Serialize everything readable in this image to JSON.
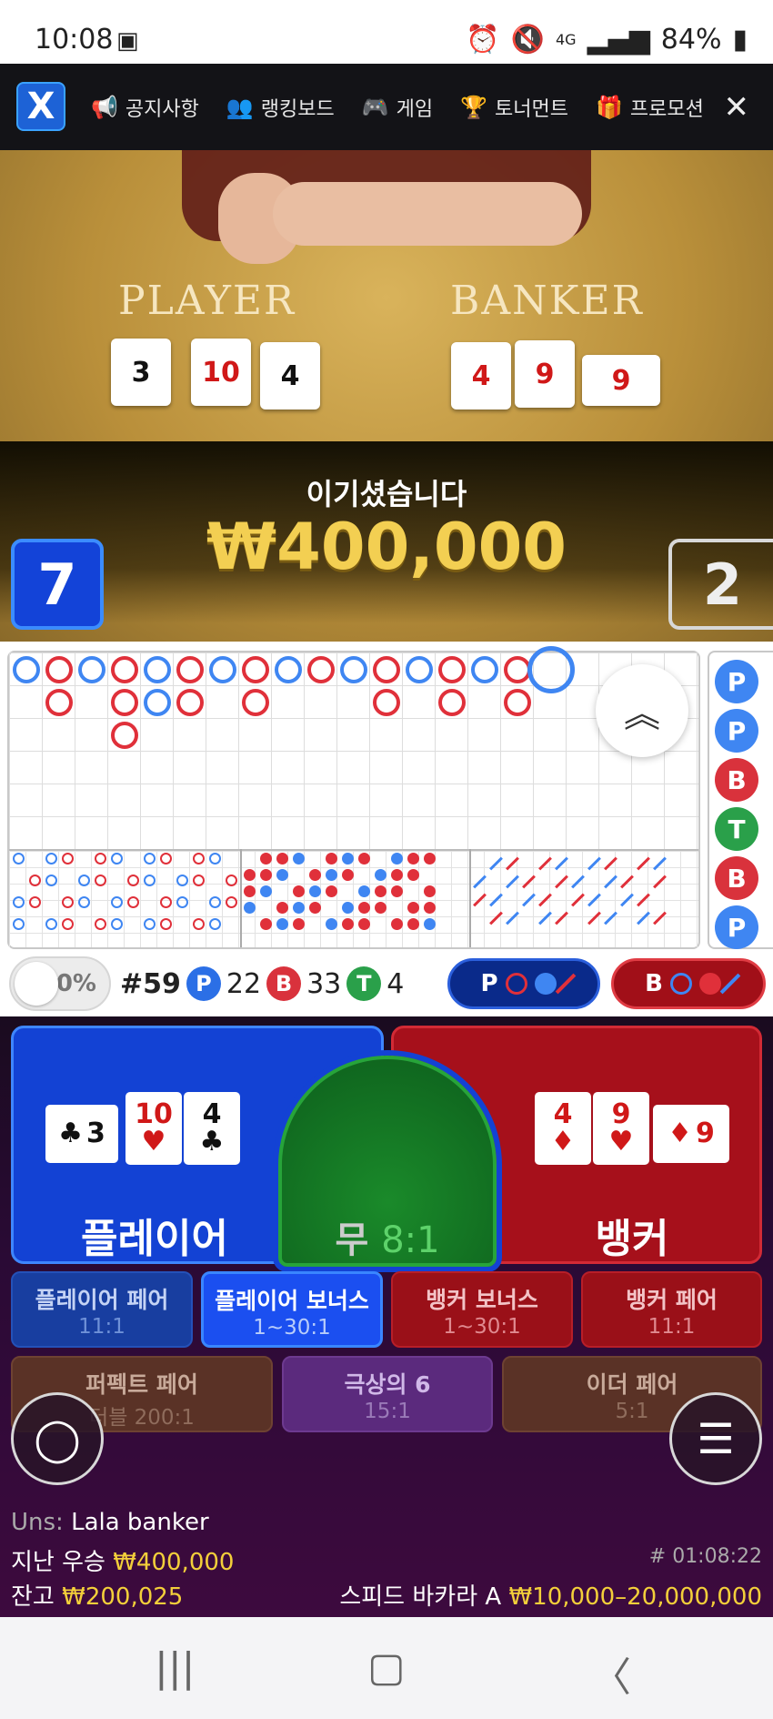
{
  "status_bar": {
    "time": "10:08",
    "battery": "84%",
    "network": "4G"
  },
  "nav": {
    "items": [
      {
        "label": "공지사항",
        "icon": "megaphone-icon"
      },
      {
        "label": "랭킹보드",
        "icon": "users-icon"
      },
      {
        "label": "게임",
        "icon": "gamepad-icon"
      },
      {
        "label": "토너먼트",
        "icon": "trophy-icon"
      },
      {
        "label": "프로모션",
        "icon": "gift-icon"
      }
    ]
  },
  "table": {
    "player_label": "PLAYER",
    "banker_label": "BANKER",
    "player_cards": [
      "3",
      "10",
      "4"
    ],
    "banker_cards": [
      "4",
      "9",
      "9"
    ],
    "win_text": "이기셨습니다",
    "win_amount": "₩400,000",
    "player_score": "7",
    "banker_score": "2"
  },
  "side_road": [
    "P",
    "P",
    "B",
    "T",
    "B",
    "P"
  ],
  "stats": {
    "percent": "0%",
    "round": "#59",
    "p_letter": "P",
    "p_count": "22",
    "b_letter": "B",
    "b_count": "33",
    "t_letter": "T",
    "t_count": "4",
    "ask_player": "P",
    "ask_banker": "B"
  },
  "bets": {
    "player_label": "플레이어",
    "banker_label": "뱅커",
    "tie_label": "무",
    "tie_odds": "8:1",
    "player_cards": [
      {
        "rank": "3",
        "suit": "♣"
      },
      {
        "rank": "10",
        "suit": "♥"
      },
      {
        "rank": "4",
        "suit": "♣"
      }
    ],
    "banker_cards": [
      {
        "rank": "4",
        "suit": "♦"
      },
      {
        "rank": "9",
        "suit": "♥"
      },
      {
        "rank": "9",
        "suit": "♦"
      }
    ],
    "side": [
      {
        "name": "플레이어 페어",
        "odds": "11:1"
      },
      {
        "name": "플레이어 보너스",
        "odds": "1~30:1"
      },
      {
        "name": "뱅커 보너스",
        "odds": "1~30:1"
      },
      {
        "name": "뱅커 페어",
        "odds": "11:1"
      },
      {
        "name": "퍼펙트 페어",
        "odds": "더블 200:1"
      },
      {
        "name": "극상의 6",
        "odds": "15:1"
      },
      {
        "name": "이더 페어",
        "odds": "5:1"
      }
    ]
  },
  "footer": {
    "user_prefix": "Uns:",
    "user_name": "Lala banker",
    "last_win_label": "지난 우승",
    "last_win_value": "₩400,000",
    "balance_label": "잔고",
    "balance_value": "₩200,025",
    "round_id": "# 01:08:22",
    "table_name": "스피드 바카라 A",
    "limits": "₩10,000–20,000,000"
  },
  "colors": {
    "player": "#1342d4",
    "banker": "#a6101b",
    "tie": "#1a8a2a",
    "gold": "#f3cf52"
  }
}
